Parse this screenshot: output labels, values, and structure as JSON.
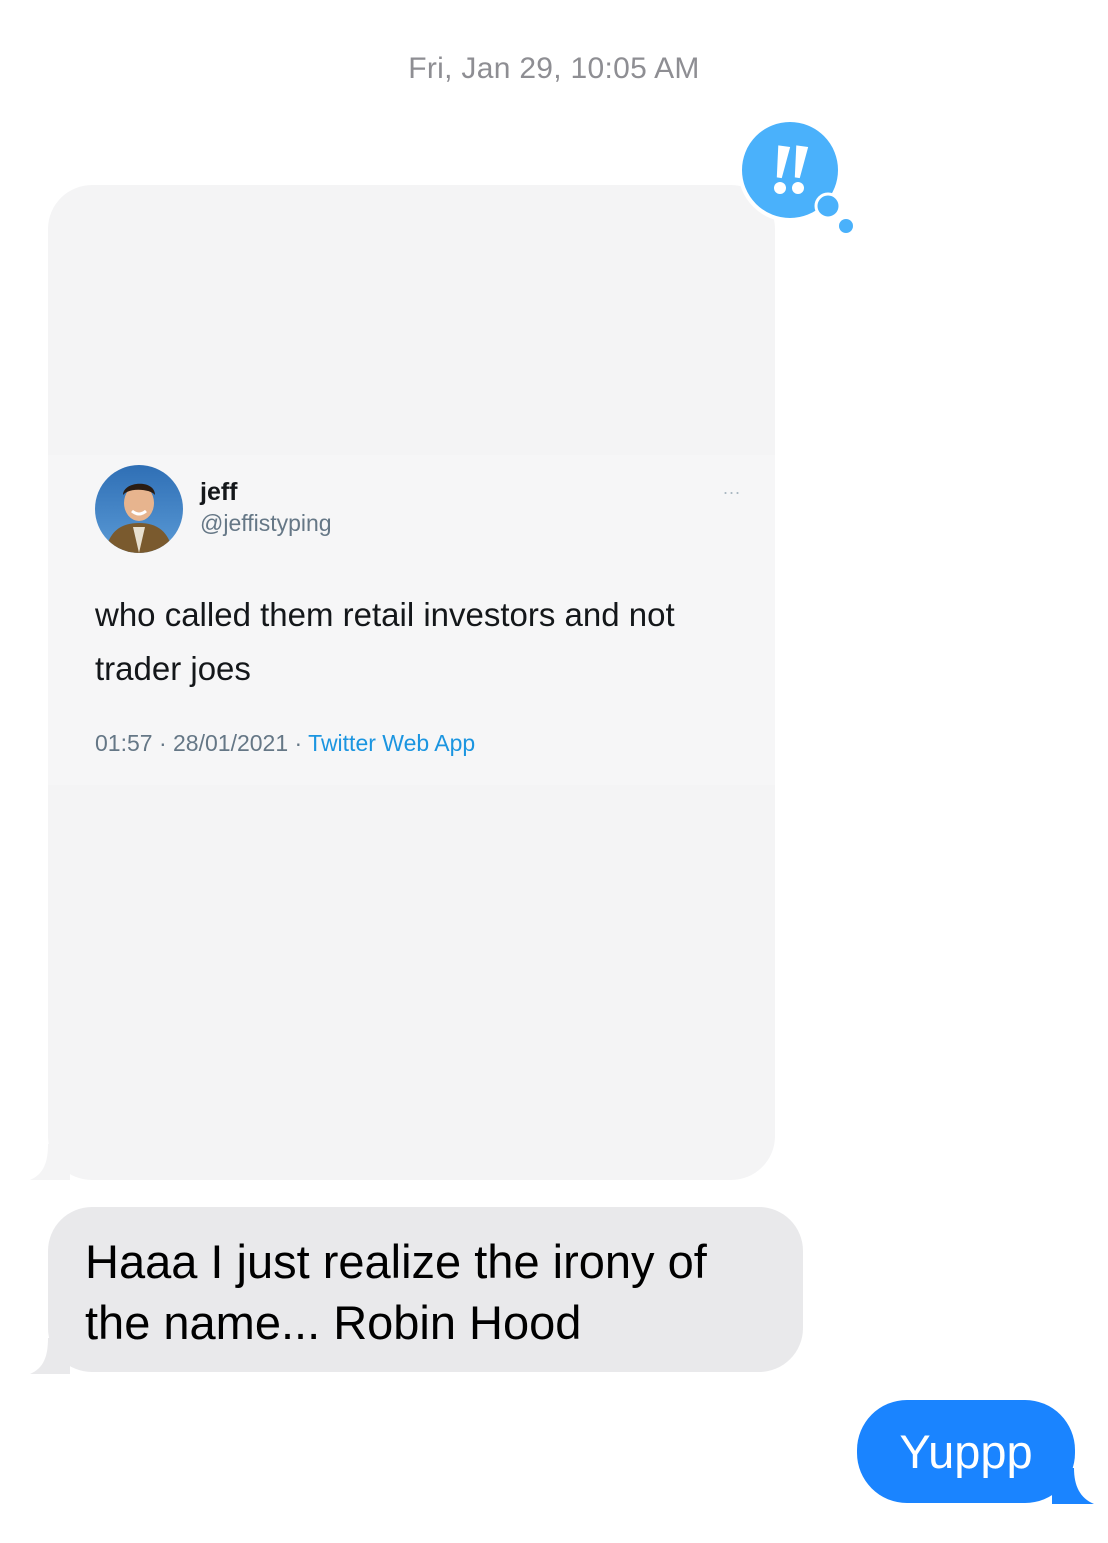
{
  "conversation": {
    "timestamp": "Fri, Jan 29, 10:05 AM"
  },
  "messages": [
    {
      "type": "image",
      "direction": "received",
      "tapback": {
        "icon": "double-exclamation-icon",
        "color": "#4ab1fb"
      },
      "tweet": {
        "name": "jeff",
        "handle": "@jeffistyping",
        "more": "...",
        "text": "who called them retail investors and not trader joes",
        "time": "01:57",
        "date": "28/01/2021",
        "source": "Twitter Web App",
        "separator": " · "
      }
    },
    {
      "type": "text",
      "direction": "received",
      "text": "Haaa I just realize the irony of the name... Robin Hood",
      "bubble_color": "#e9e9eb"
    },
    {
      "type": "text",
      "direction": "sent",
      "text": "Yuppp",
      "bubble_color": "#1a84ff"
    }
  ]
}
